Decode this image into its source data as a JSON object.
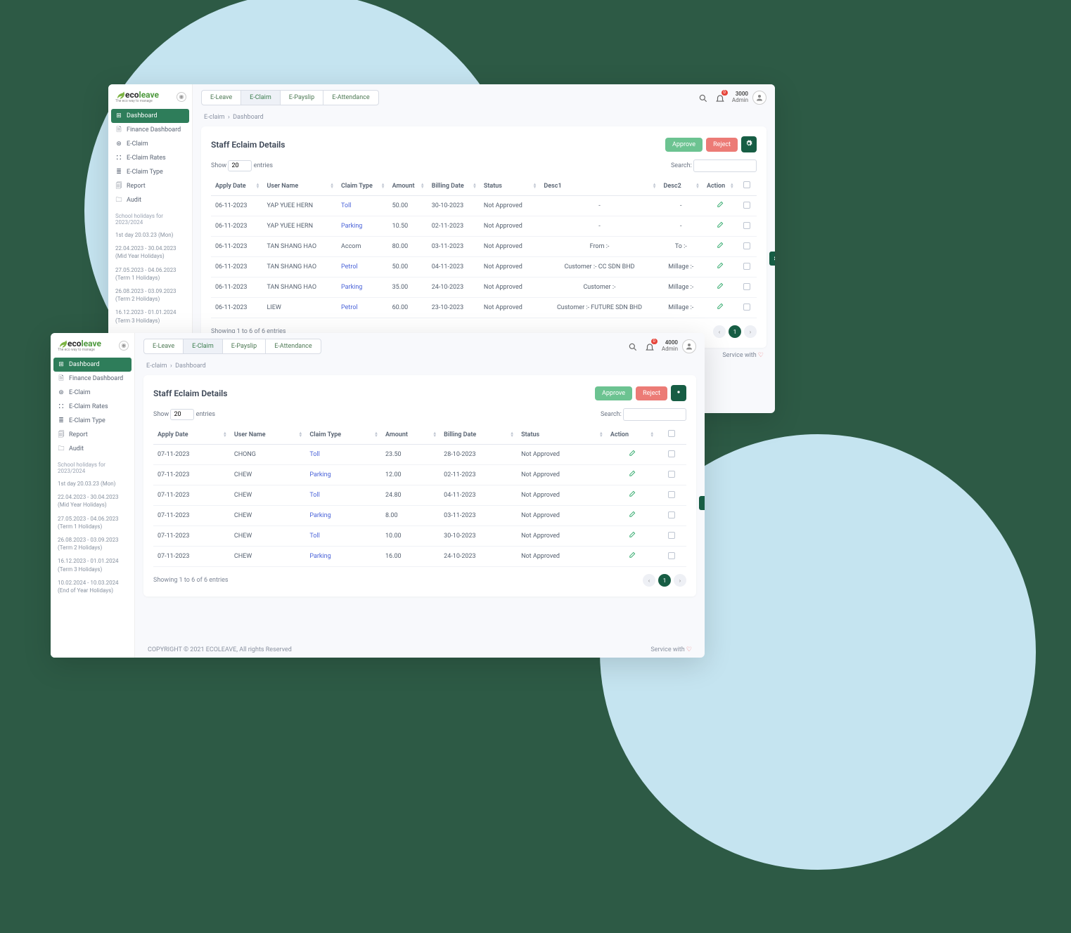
{
  "logo": {
    "name": "ecoleave",
    "tagline": "The eco way to manage"
  },
  "sidebar": {
    "items": [
      {
        "label": "Dashboard",
        "icon": "grid-icon",
        "active": true
      },
      {
        "label": "Finance Dashboard",
        "icon": "file-icon"
      },
      {
        "label": "E-Claim",
        "icon": "globe-icon"
      },
      {
        "label": "E-Claim Rates",
        "icon": "gift-icon"
      },
      {
        "label": "E-Claim Type",
        "icon": "list-icon"
      },
      {
        "label": "Report",
        "icon": "report-icon"
      },
      {
        "label": "Audit",
        "icon": "audit-icon"
      }
    ],
    "heading": "School holidays for 2023/2024",
    "notes": [
      "1st day 20.03.23 (Mon)",
      "22.04.2023 - 30.04.2023\n(Mid Year Holidays)",
      "27.05.2023 - 04.06.2023\n(Term 1 Holidays)",
      "26.08.2023 - 03.09.2023\n(Term 2 Holidays)",
      "16.12.2023 - 01.01.2024\n(Term 3 Holidays)"
    ],
    "extra_note_win2": "10.02.2024 - 10.03.2024\n(End of Year Holidays)"
  },
  "tabs": [
    "E-Leave",
    "E-Claim",
    "E-Payslip",
    "E-Attendance"
  ],
  "active_tab": "E-Claim",
  "bell_badge": "0",
  "win1_user": {
    "id": "3000",
    "role": "Admin"
  },
  "win2_user": {
    "id": "4000",
    "role": "Admin"
  },
  "breadcrumb": {
    "a": "E-claim",
    "b": "Dashboard"
  },
  "card": {
    "title": "Staff Eclaim Details",
    "approve": "Approve",
    "reject": "Reject",
    "show": "Show",
    "entries_label": "entries",
    "entries_value": "20",
    "search": "Search:"
  },
  "win1_columns": [
    "Apply Date",
    "User Name",
    "Claim Type",
    "Amount",
    "Billing Date",
    "Status",
    "Desc1",
    "Desc2",
    "Action"
  ],
  "win1_rows": [
    {
      "date": "06-11-2023",
      "user": "YAP YUEE HERN",
      "type": "Toll",
      "link": true,
      "amt": "50.00",
      "bill": "30-10-2023",
      "status": "Not Approved",
      "d1": "-",
      "d2": "-"
    },
    {
      "date": "06-11-2023",
      "user": "YAP YUEE HERN",
      "type": "Parking",
      "link": true,
      "amt": "10.50",
      "bill": "02-11-2023",
      "status": "Not Approved",
      "d1": "-",
      "d2": "-"
    },
    {
      "date": "06-11-2023",
      "user": "TAN SHANG HAO",
      "type": "Accom",
      "link": false,
      "amt": "80.00",
      "bill": "03-11-2023",
      "status": "Not Approved",
      "d1": "From :-",
      "d2": "To :-"
    },
    {
      "date": "06-11-2023",
      "user": "TAN SHANG HAO",
      "type": "Petrol",
      "link": true,
      "amt": "50.00",
      "bill": "04-11-2023",
      "status": "Not Approved",
      "d1": "Customer :- CC SDN BHD",
      "d2": "Millage :-"
    },
    {
      "date": "06-11-2023",
      "user": "TAN SHANG HAO",
      "type": "Parking",
      "link": true,
      "amt": "35.00",
      "bill": "24-10-2023",
      "status": "Not Approved",
      "d1": "Customer :-",
      "d2": "Millage :-"
    },
    {
      "date": "06-11-2023",
      "user": "LIEW",
      "type": "Petrol",
      "link": true,
      "amt": "60.00",
      "bill": "23-10-2023",
      "status": "Not Approved",
      "d1": "Customer :- FUTURE SDN BHD",
      "d2": "Millage :-"
    }
  ],
  "win2_columns": [
    "Apply Date",
    "User Name",
    "Claim Type",
    "Amount",
    "Billing Date",
    "Status",
    "Action"
  ],
  "win2_rows": [
    {
      "date": "07-11-2023",
      "user": "CHONG",
      "type": "Toll",
      "link": true,
      "amt": "23.50",
      "bill": "28-10-2023",
      "status": "Not Approved"
    },
    {
      "date": "07-11-2023",
      "user": "CHEW",
      "type": "Parking",
      "link": true,
      "amt": "12.00",
      "bill": "02-11-2023",
      "status": "Not Approved"
    },
    {
      "date": "07-11-2023",
      "user": "CHEW",
      "type": "Toll",
      "link": true,
      "amt": "24.80",
      "bill": "04-11-2023",
      "status": "Not Approved"
    },
    {
      "date": "07-11-2023",
      "user": "CHEW",
      "type": "Parking",
      "link": true,
      "amt": "8.00",
      "bill": "03-11-2023",
      "status": "Not Approved"
    },
    {
      "date": "07-11-2023",
      "user": "CHEW",
      "type": "Toll",
      "link": true,
      "amt": "10.00",
      "bill": "30-10-2023",
      "status": "Not Approved"
    },
    {
      "date": "07-11-2023",
      "user": "CHEW",
      "type": "Parking",
      "link": true,
      "amt": "16.00",
      "bill": "24-10-2023",
      "status": "Not Approved"
    }
  ],
  "table_info": "Showing 1 to 6 of 6 entries",
  "page_current": "1",
  "service": "Service with",
  "copyright": "COPYRIGHT © 2021 ECOLEAVE, All rights Reserved"
}
